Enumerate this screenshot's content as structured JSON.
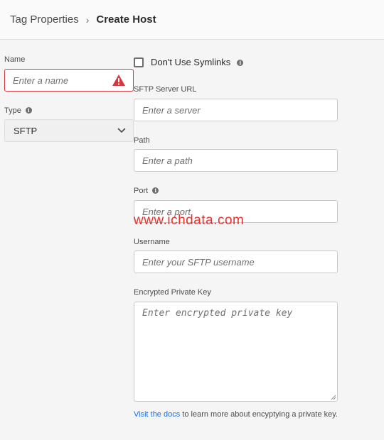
{
  "breadcrumb": {
    "parent": "Tag Properties",
    "separator": "›",
    "current": "Create Host"
  },
  "form": {
    "name": {
      "label": "Name",
      "placeholder": "Enter a name",
      "value": "",
      "state": "invalid"
    },
    "type": {
      "label": "Type",
      "value": "SFTP"
    },
    "symlinks": {
      "label": "Don't Use Symlinks",
      "checked": false
    },
    "server_url": {
      "label": "SFTP Server URL",
      "placeholder": "Enter a server",
      "value": ""
    },
    "path": {
      "label": "Path",
      "placeholder": "Enter a path",
      "value": ""
    },
    "port": {
      "label": "Port",
      "placeholder": "Enter a port",
      "value": ""
    },
    "username": {
      "label": "Username",
      "placeholder": "Enter your SFTP username",
      "value": ""
    },
    "private_key": {
      "label": "Encrypted Private Key",
      "placeholder": "Enter encrypted private key",
      "value": ""
    }
  },
  "help": {
    "link_text": "Visit the docs",
    "rest_text": " to learn more about encyptying a private key."
  },
  "watermark": "www.ichdata.com",
  "colors": {
    "error": "#d7373f",
    "link": "#1473e6",
    "watermark": "#e8322f"
  },
  "icons": {
    "info": "info-icon",
    "alert": "alert-icon",
    "chevron": "chevron-down-icon"
  }
}
